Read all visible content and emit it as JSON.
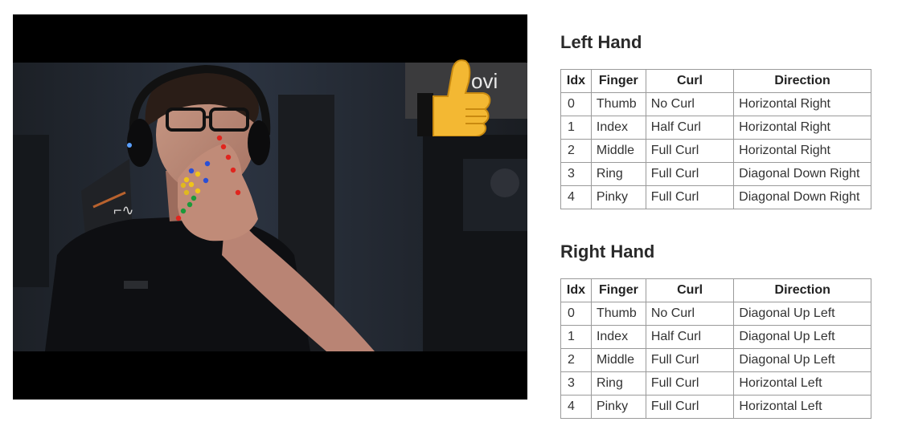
{
  "video": {
    "overlay_text": "ovi",
    "emoji": "thumbs-up",
    "keypoint_colors": [
      "#e0251e",
      "#f0c419",
      "#2a4fd6",
      "#1a9a3a",
      "#e0b820"
    ]
  },
  "columns": [
    "Idx",
    "Finger",
    "Curl",
    "Direction"
  ],
  "left_hand": {
    "title": "Left Hand",
    "rows": [
      {
        "idx": "0",
        "finger": "Thumb",
        "curl": "No Curl",
        "direction": "Horizontal Right"
      },
      {
        "idx": "1",
        "finger": "Index",
        "curl": "Half Curl",
        "direction": "Horizontal Right"
      },
      {
        "idx": "2",
        "finger": "Middle",
        "curl": "Full Curl",
        "direction": "Horizontal Right"
      },
      {
        "idx": "3",
        "finger": "Ring",
        "curl": "Full Curl",
        "direction": "Diagonal Down Right"
      },
      {
        "idx": "4",
        "finger": "Pinky",
        "curl": "Full Curl",
        "direction": "Diagonal Down Right"
      }
    ]
  },
  "right_hand": {
    "title": "Right Hand",
    "rows": [
      {
        "idx": "0",
        "finger": "Thumb",
        "curl": "No Curl",
        "direction": "Diagonal Up Left"
      },
      {
        "idx": "1",
        "finger": "Index",
        "curl": "Half Curl",
        "direction": "Diagonal Up Left"
      },
      {
        "idx": "2",
        "finger": "Middle",
        "curl": "Full Curl",
        "direction": "Diagonal Up Left"
      },
      {
        "idx": "3",
        "finger": "Ring",
        "curl": "Full Curl",
        "direction": "Horizontal Left"
      },
      {
        "idx": "4",
        "finger": "Pinky",
        "curl": "Full Curl",
        "direction": "Horizontal Left"
      }
    ]
  }
}
